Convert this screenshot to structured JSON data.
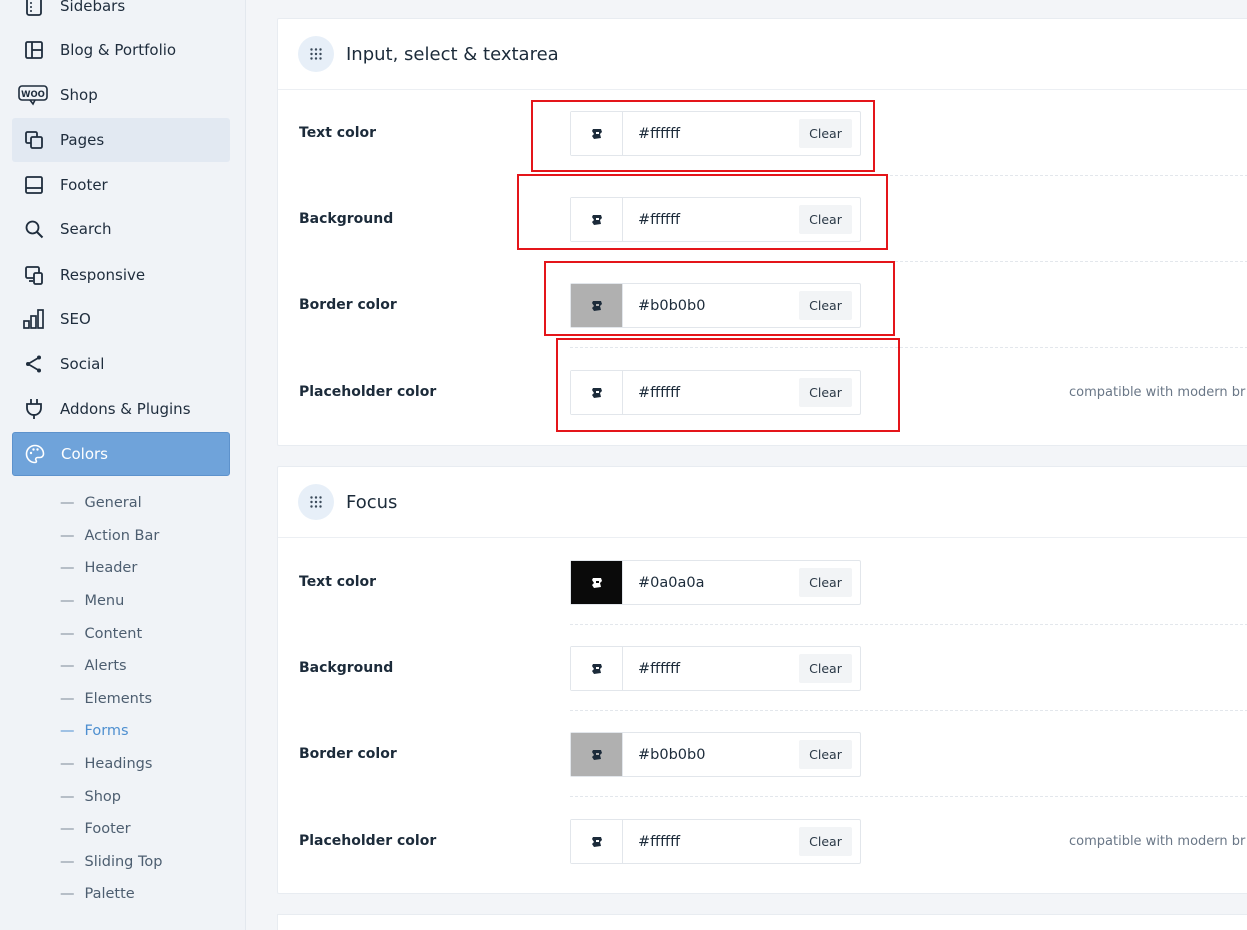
{
  "sidebar": {
    "items": [
      {
        "label": "Sidebars",
        "icon": "sidebars-icon"
      },
      {
        "label": "Blog & Portfolio",
        "icon": "blog-layout-icon"
      },
      {
        "label": "Shop",
        "icon": "woo-icon"
      },
      {
        "label": "Pages",
        "icon": "pages-icon"
      },
      {
        "label": "Footer",
        "icon": "footer-icon"
      },
      {
        "label": "Search",
        "icon": "search-icon"
      },
      {
        "label": "Responsive",
        "icon": "responsive-icon"
      },
      {
        "label": "SEO",
        "icon": "seo-chart-icon"
      },
      {
        "label": "Social",
        "icon": "share-icon"
      },
      {
        "label": "Addons & Plugins",
        "icon": "plug-icon"
      },
      {
        "label": "Colors",
        "icon": "palette-icon"
      }
    ],
    "woo_text": "WOO",
    "dash": "—",
    "sub_items": [
      "General",
      "Action Bar",
      "Header",
      "Menu",
      "Content",
      "Alerts",
      "Elements",
      "Forms",
      "Headings",
      "Shop",
      "Footer",
      "Sliding Top",
      "Palette"
    ],
    "current_sub": "Forms"
  },
  "panels": [
    {
      "title": "Input, select & textarea",
      "icon": "drag-grid-icon",
      "rows": [
        {
          "label": "Text color",
          "value": "#ffffff",
          "swatch": "#ffffff",
          "clear": "Clear"
        },
        {
          "label": "Background",
          "value": "#ffffff",
          "swatch": "#ffffff",
          "clear": "Clear"
        },
        {
          "label": "Border color",
          "value": "#b0b0b0",
          "swatch": "#b0b0b0",
          "clear": "Clear"
        },
        {
          "label": "Placeholder color",
          "value": "#ffffff",
          "swatch": "#ffffff",
          "clear": "Clear",
          "note": "compatible with modern br"
        }
      ]
    },
    {
      "title": "Focus",
      "icon": "drag-grid-icon",
      "rows": [
        {
          "label": "Text color",
          "value": "#0a0a0a",
          "swatch": "#0a0a0a",
          "clear": "Clear"
        },
        {
          "label": "Background",
          "value": "#ffffff",
          "swatch": "#ffffff",
          "clear": "Clear"
        },
        {
          "label": "Border color",
          "value": "#b0b0b0",
          "swatch": "#b0b0b0",
          "clear": "Clear"
        },
        {
          "label": "Placeholder color",
          "value": "#ffffff",
          "swatch": "#ffffff",
          "clear": "Clear",
          "note": "compatible with modern br"
        }
      ]
    }
  ],
  "colors": {
    "accent": "#6fa3da",
    "highlight_box": "#e4151a",
    "current_link": "#4e8fd0"
  }
}
